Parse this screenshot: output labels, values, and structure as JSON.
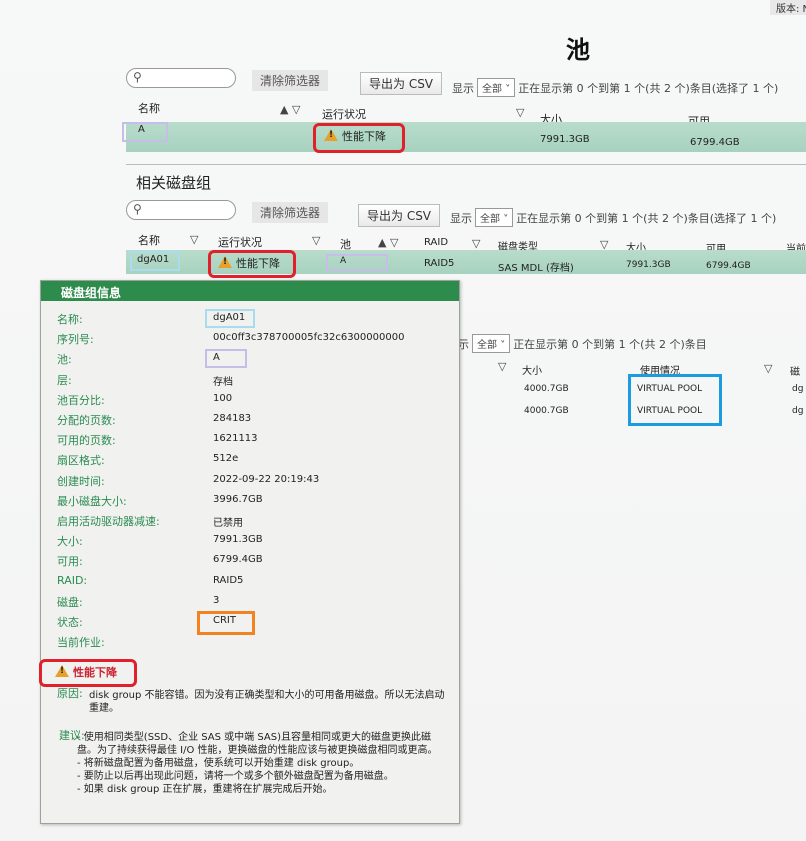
{
  "page": {
    "title": "池",
    "version_label": "版本: N"
  },
  "pools": {
    "clear_filter": "清除筛选器",
    "export": "导出为 CSV",
    "show_label": "显示",
    "show_value": "全部",
    "status_text": "正在显示第 0 个到第 1 个(共 2 个)条目(选择了 1 个)",
    "columns": {
      "name": "名称",
      "health": "运行状况",
      "size": "大小",
      "available": "可用"
    },
    "row": {
      "name": "A",
      "health": "性能下降",
      "size": "7991.3GB",
      "available": "6799.4GB"
    }
  },
  "disk_groups": {
    "section_title": "相关磁盘组",
    "clear_filter": "清除筛选器",
    "export": "导出为 CSV",
    "show_label": "显示",
    "show_value": "全部",
    "status_text": "正在显示第 0 个到第 1 个(共 2 个)条目(选择了 1 个)",
    "columns": {
      "name": "名称",
      "health": "运行状况",
      "pool": "池",
      "raid": "RAID",
      "disk_type": "磁盘类型",
      "size": "大小",
      "available": "可用",
      "current": "当前"
    },
    "row": {
      "name": "dgA01",
      "health": "性能下降",
      "pool": "A",
      "raid": "RAID5",
      "disk_type": "SAS MDL (存档)",
      "size": "7991.3GB",
      "available": "6799.4GB"
    }
  },
  "disks": {
    "show_label": "示",
    "show_value": "全部",
    "status_text": "正在显示第 0 个到第 1 个(共 2 个)条目",
    "columns": {
      "size": "大小",
      "usage": "使用情况",
      "extra": "磁"
    },
    "rows": [
      {
        "size": "4000.7GB",
        "usage": "VIRTUAL POOL",
        "extra": "dg"
      },
      {
        "size": "4000.7GB",
        "usage": "VIRTUAL POOL",
        "extra": "dg"
      }
    ]
  },
  "info_panel": {
    "title": "磁盘组信息",
    "fields": [
      {
        "label": "名称:",
        "value": "dgA01"
      },
      {
        "label": "序列号:",
        "value": "00c0ff3c378700005fc32c6300000000"
      },
      {
        "label": "池:",
        "value": "A"
      },
      {
        "label": "层:",
        "value": "存档"
      },
      {
        "label": "池百分比:",
        "value": "100"
      },
      {
        "label": "分配的页数:",
        "value": "284183"
      },
      {
        "label": "可用的页数:",
        "value": "1621113"
      },
      {
        "label": "扇区格式:",
        "value": "512e"
      },
      {
        "label": "创建时间:",
        "value": "2022-09-22 20:19:43"
      },
      {
        "label": "最小磁盘大小:",
        "value": "3996.7GB"
      },
      {
        "label": "启用活动驱动器减速:",
        "value": "已禁用"
      },
      {
        "label": "大小:",
        "value": "7991.3GB"
      },
      {
        "label": "可用:",
        "value": "6799.4GB"
      },
      {
        "label": "RAID:",
        "value": "RAID5"
      },
      {
        "label": "磁盘:",
        "value": "3"
      },
      {
        "label": "状态:",
        "value": "CRIT"
      },
      {
        "label": "当前作业:",
        "value": ""
      }
    ],
    "health_label": "性能下降",
    "reason_label": "原因:",
    "reason_text": "disk group 不能容错。因为没有正确类型和大小的可用备用磁盘。所以无法启动重建。",
    "advice_label": "建议:",
    "advice_lines": [
      "- 使用相同类型(SSD、企业 SAS 或中端 SAS)且容量相同或更大的磁盘更换此磁盘。为了持续获得最佳 I/O 性能，更换磁盘的性能应该与被更换磁盘相同或更高。",
      "- 将新磁盘配置为备用磁盘，使系统可以开始重建 disk group。",
      "- 要防止以后再出现此问题，请将一个或多个额外磁盘配置为备用磁盘。",
      "- 如果 disk group 正在扩展，重建将在扩展完成后开始。"
    ]
  }
}
